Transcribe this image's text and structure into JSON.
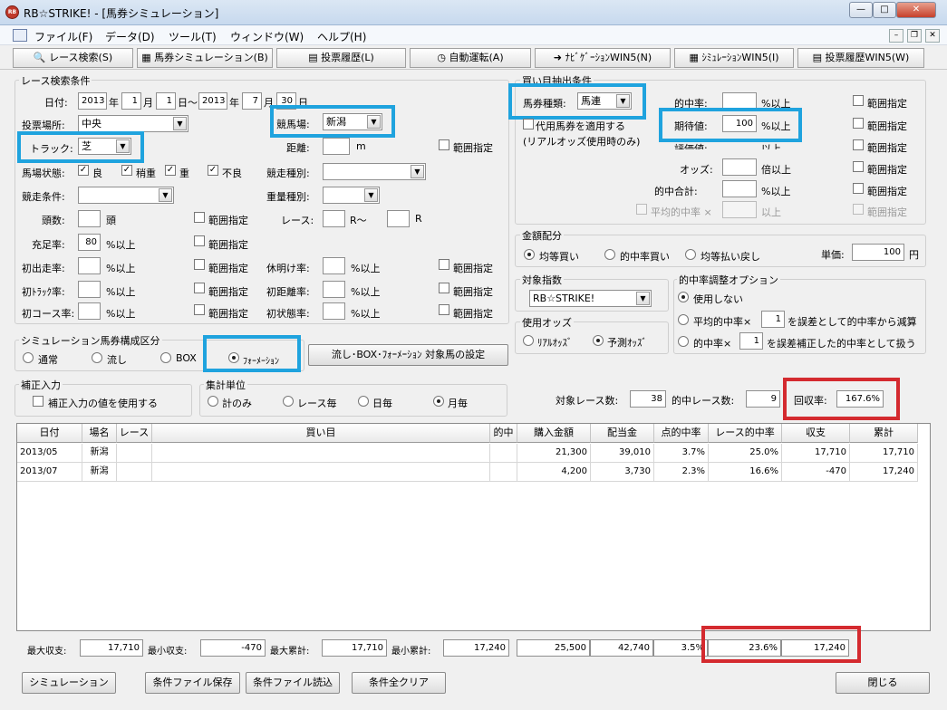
{
  "window": {
    "title": "RB☆STRIKE! - [馬券シミュレーション]",
    "app_icon": "RB",
    "min": "—",
    "max": "□",
    "close": "✕"
  },
  "menu": [
    {
      "label": "ファイル(F)"
    },
    {
      "label": "データ(D)"
    },
    {
      "label": "ツール(T)"
    },
    {
      "label": "ウィンドウ(W)"
    },
    {
      "label": "ヘルプ(H)"
    }
  ],
  "mdi": {
    "min": "–",
    "restore": "❐",
    "close": "✕"
  },
  "toolbar": [
    {
      "label": "レース検索(S)",
      "icon": "🔍"
    },
    {
      "label": "馬券シミュレーション(B)",
      "icon": "▦"
    },
    {
      "label": "投票履歴(L)",
      "icon": "▤"
    },
    {
      "label": "自動運転(A)",
      "icon": "◷"
    },
    {
      "label": "ﾅﾋﾞｹﾞｰｼｮﾝWIN5(N)",
      "icon": "➜"
    },
    {
      "label": "ｼﾐｭﾚｰｼｮﾝWIN5(I)",
      "icon": "▦"
    },
    {
      "label": "投票履歴WIN5(W)",
      "icon": "▤"
    }
  ],
  "race": {
    "group": "レース検索条件",
    "date_label": "日付:",
    "year_u": "年",
    "month_u": "月",
    "day_u": "日～",
    "from_y": "2013",
    "from_m": "1",
    "from_d": "1",
    "to_y": "2013",
    "to_m": "7",
    "to_d": "30",
    "place_label": "投票場所:",
    "place_value": "中央",
    "venue_label": "競馬場:",
    "venue_value": "新潟",
    "track_label": "トラック:",
    "track_value": "芝",
    "distance_label": "距離:",
    "distance_unit": "m",
    "range": "範囲指定",
    "condition_label": "馬場状態:",
    "conds": [
      "良",
      "稍重",
      "重",
      "不良"
    ],
    "conds_checked": [
      true,
      true,
      true,
      true
    ],
    "rtype_label": "競走種別:",
    "cond2_label": "競走条件:",
    "weight_label": "重量種別:",
    "heads_label": "頭数:",
    "heads_unit": "頭",
    "race_label": "レース:",
    "r_from": "R～",
    "r_to": "R",
    "fill_label": "充足率:",
    "fill_value": "80",
    "pct_up": "%以上",
    "first_run": "初出走率:",
    "rest": "休明け率:",
    "first_track": "初ﾄﾗｯｸ率:",
    "first_dist": "初距離率:",
    "first_course": "初コース率:",
    "first_state": "初状態率:"
  },
  "buy": {
    "group": "買い目抽出条件",
    "kind_label": "馬券種類:",
    "kind_value": "馬連",
    "rate_label": "的中率:",
    "exp_label": "期待値:",
    "exp_value": "100",
    "pct_up": "%以上",
    "range": "範囲指定",
    "substitute": "代用馬券を適用する",
    "realodds_note": "(リアルオッズ使用時のみ)",
    "eval_label": "評価値:",
    "eval_suffix": "以上",
    "odds_label": "オッズ:",
    "odds_unit": "倍以上",
    "sum_label": "的中合計:",
    "avg_label": "平均的中率 ×",
    "avg_suffix": "以上"
  },
  "money": {
    "group": "金額配分",
    "opts": [
      "均等買い",
      "的中率買い",
      "均等払い戻し"
    ],
    "price_label": "単価:",
    "price_value": "100",
    "price_unit": "円"
  },
  "index": {
    "group": "対象指数",
    "value": "RB☆STRIKE!"
  },
  "odds": {
    "group": "使用オッズ",
    "opts": [
      "ﾘｱﾙｵｯｽﾞ",
      "予測ｵｯｽﾞ"
    ]
  },
  "adjust": {
    "group": "的中率調整オプション",
    "opt1": "使用しない",
    "opt2a": "平均的中率×",
    "opt2v": "1",
    "opt2b": "を誤差として的中率から減算",
    "opt3a": "的中率×",
    "opt3v": "1",
    "opt3b": "を誤差補正した的中率として扱う"
  },
  "sim": {
    "group": "シミュレーション馬券構成区分",
    "opts": [
      "通常",
      "流し",
      "BOX",
      "ﾌｫｰﾒｰｼｮﾝ"
    ],
    "setting_button": "流し･BOX･ﾌｫｰﾒｰｼｮﾝ 対象馬の設定"
  },
  "corr": {
    "group": "補正入力",
    "label": "補正入力の値を使用する"
  },
  "unit": {
    "group": "集計単位",
    "opts": [
      "計のみ",
      "レース毎",
      "日毎",
      "月毎"
    ]
  },
  "stats": {
    "target_label": "対象レース数:",
    "target_value": "38",
    "hit_label": "的中レース数:",
    "hit_value": "9",
    "recovery_label": "回収率:",
    "recovery_value": "167.6%"
  },
  "table": {
    "headers": [
      "日付",
      "場名",
      "レース",
      "買い目",
      "的中",
      "購入金額",
      "配当金",
      "点的中率",
      "レース的中率",
      "収支",
      "累計"
    ],
    "rows": [
      [
        "2013/05",
        "新潟",
        "",
        "",
        "",
        "21,300",
        "39,010",
        "3.7%",
        "25.0%",
        "17,710",
        "17,710"
      ],
      [
        "2013/07",
        "新潟",
        "",
        "",
        "",
        "4,200",
        "3,730",
        "2.3%",
        "16.6%",
        "-470",
        "17,240"
      ]
    ]
  },
  "footer": {
    "max_income_label": "最大収支:",
    "max_income": "17,710",
    "min_income_label": "最小収支:",
    "min_income": "-470",
    "max_cum_label": "最大累計:",
    "max_cum": "17,710",
    "min_cum_label": "最小累計:",
    "min_cum": "17,240",
    "buy_total": "25,500",
    "pay_total": "42,740",
    "point_rate": "3.5%",
    "race_rate": "23.6%",
    "balance": "17,240"
  },
  "buttons": {
    "simulate": "シミュレーション",
    "save": "条件ファイル保存",
    "load": "条件ファイル読込",
    "clear": "条件全クリア",
    "close": "閉じる"
  },
  "colors": {
    "highlight_blue": "#1fa3de",
    "highlight_red": "#d42a2f"
  }
}
